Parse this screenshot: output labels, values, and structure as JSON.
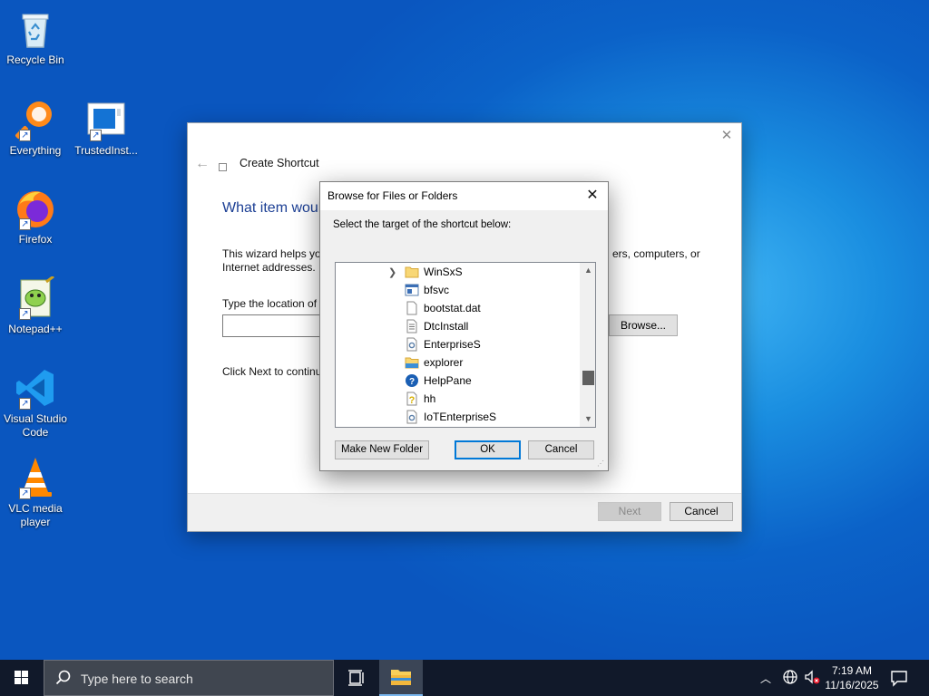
{
  "desktop": {
    "icons": [
      {
        "label": "Recycle Bin"
      },
      {
        "label": "Everything"
      },
      {
        "label": "TrustedInst..."
      },
      {
        "label": "Firefox"
      },
      {
        "label": "Notepad++"
      },
      {
        "label": "Visual Studio Code"
      },
      {
        "label": "VLC media player"
      }
    ]
  },
  "wizard": {
    "title": "Create Shortcut",
    "heading": "What item woul",
    "desc_left": "This wizard helps you",
    "desc_left_line2": "Internet addresses.",
    "desc_right": "ers, computers, or",
    "location_label": "Type the location of t",
    "location_value": "",
    "browse_label": "Browse...",
    "next_text": "Click Next to continu",
    "next_label": "Next",
    "cancel_label": "Cancel"
  },
  "dialog": {
    "title": "Browse for Files or Folders",
    "prompt": "Select the target of the shortcut below:",
    "tree_items": [
      {
        "label": "WinSxS",
        "icon": "folder-icon",
        "expandable": true
      },
      {
        "label": "bfsvc",
        "icon": "app-icon"
      },
      {
        "label": "bootstat.dat",
        "icon": "file-icon"
      },
      {
        "label": "DtcInstall",
        "icon": "text-file-icon"
      },
      {
        "label": "EnterpriseS",
        "icon": "settings-file-icon"
      },
      {
        "label": "explorer",
        "icon": "explorer-icon"
      },
      {
        "label": "HelpPane",
        "icon": "help-icon"
      },
      {
        "label": "hh",
        "icon": "help-file-icon"
      },
      {
        "label": "IoTEnterpriseS",
        "icon": "settings-file-icon"
      }
    ],
    "new_folder_label": "Make New Folder",
    "ok_label": "OK",
    "cancel_label": "Cancel"
  },
  "taskbar": {
    "search_placeholder": "Type here to search",
    "time": "7:19 AM",
    "date": "11/16/2025"
  }
}
